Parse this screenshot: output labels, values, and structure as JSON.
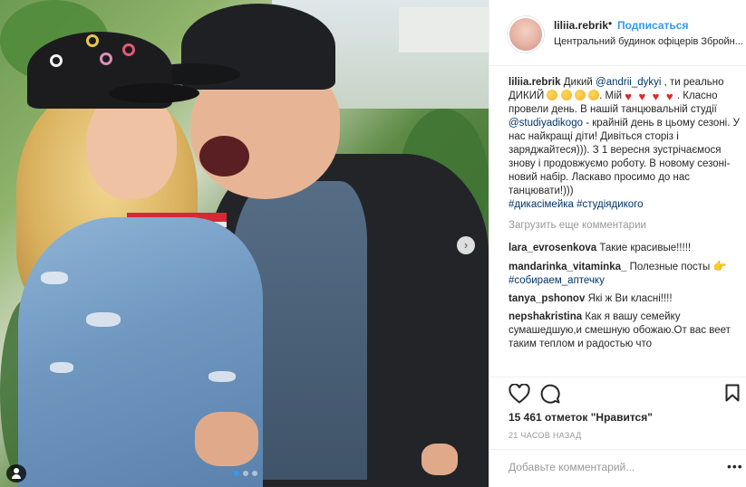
{
  "post": {
    "photo_alt": "",
    "carousel": {
      "count": 3,
      "active": 0
    }
  },
  "header": {
    "username": "liliia.rebrik",
    "separator": "•",
    "follow_label": "Подписаться",
    "location": "Центральний будинок офіцерів Збройн..."
  },
  "caption": {
    "username": "liliia.rebrik",
    "t1": " Дикий ",
    "mention1": "@andrii_dykyi",
    "t2": " , ти реально ДИКИЙ ",
    "t3": ". Мій ",
    "t4": ". Класно провели день. В нашій танцювальній студії ",
    "mention2": "@studiyadikogo",
    "t5": " - крайній день в цьому сезоні. У нас найкращі діти! Дивіться сторіз і заряджайтеся))). З 1 вересня зустрічаємося знову і продовжуємо роботу. В новому сезоні- новий набір. Ласкаво просимо до нас танцювати!)))",
    "hashtags": "#дикасімейка #студіядикого"
  },
  "load_more": "Загрузить еще комментарии",
  "comments": [
    {
      "username": "lara_evrosenkova",
      "text": "Такие красивые!!!!!"
    },
    {
      "username": "mandarinka_vitaminka_",
      "text": "Полезные посты",
      "hashtag": "#собираем_аптечку"
    },
    {
      "username": "tanya_pshonov",
      "text": "Які ж Ви класні!!!!"
    },
    {
      "username": "nepshakristina",
      "text": "Как я вашу семейку сумашедшую,и смешную обожаю.От вас веет таким теплом и радостью что"
    }
  ],
  "icons": {
    "like": "heart-icon",
    "comment": "comment-icon",
    "save": "bookmark-icon",
    "more": "more-options-icon"
  },
  "likes": "15 461 отметок \"Нравится\"",
  "time": "21 ЧАСОВ НАЗАД",
  "add_comment": {
    "placeholder": "Добавьте комментарий...",
    "more": "•••"
  },
  "colors": {
    "link": "#003569",
    "follow": "#3897f0",
    "muted": "#999999"
  }
}
